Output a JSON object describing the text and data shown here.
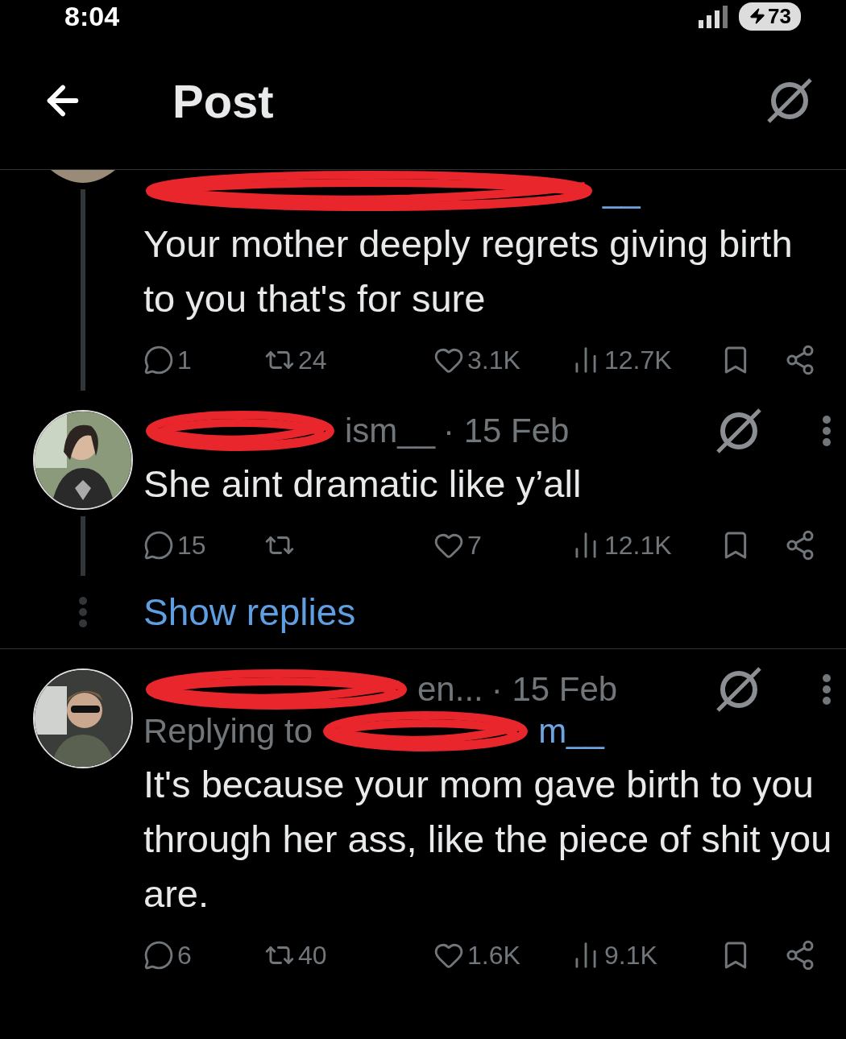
{
  "status_bar": {
    "time": "8:04",
    "battery": "73"
  },
  "header": {
    "title": "Post"
  },
  "posts": [
    {
      "kind": "continued",
      "handle_tail": "__",
      "text": "Your mother deeply regrets giving birth to you that's for sure",
      "stats": [
        {
          "kind": "reply",
          "count": "1"
        },
        {
          "kind": "repost",
          "count": "24"
        },
        {
          "kind": "like",
          "count": "3.1K"
        },
        {
          "kind": "views",
          "count": "12.7K"
        }
      ]
    },
    {
      "kind": "reply",
      "name_tail": "ism__",
      "date": "· 15 Feb",
      "text": "She aint dramatic like y’all",
      "stats": [
        {
          "kind": "reply",
          "count": "15"
        },
        {
          "kind": "repost"
        },
        {
          "kind": "like",
          "count": "7"
        },
        {
          "kind": "views",
          "count": "12.1K"
        }
      ],
      "show_replies": "Show replies"
    },
    {
      "kind": "reply",
      "name_tail": "en...",
      "date": "· 15 Feb",
      "replying_prefix": "Replying to",
      "handle_tail": "m__",
      "text": "It's because your mom gave birth to you through her ass, like the piece of shit you are.",
      "stats": [
        {
          "kind": "reply",
          "count": "6"
        },
        {
          "kind": "repost",
          "count": "40"
        },
        {
          "kind": "like",
          "count": "1.6K"
        },
        {
          "kind": "views",
          "count": "9.1K"
        }
      ]
    }
  ]
}
